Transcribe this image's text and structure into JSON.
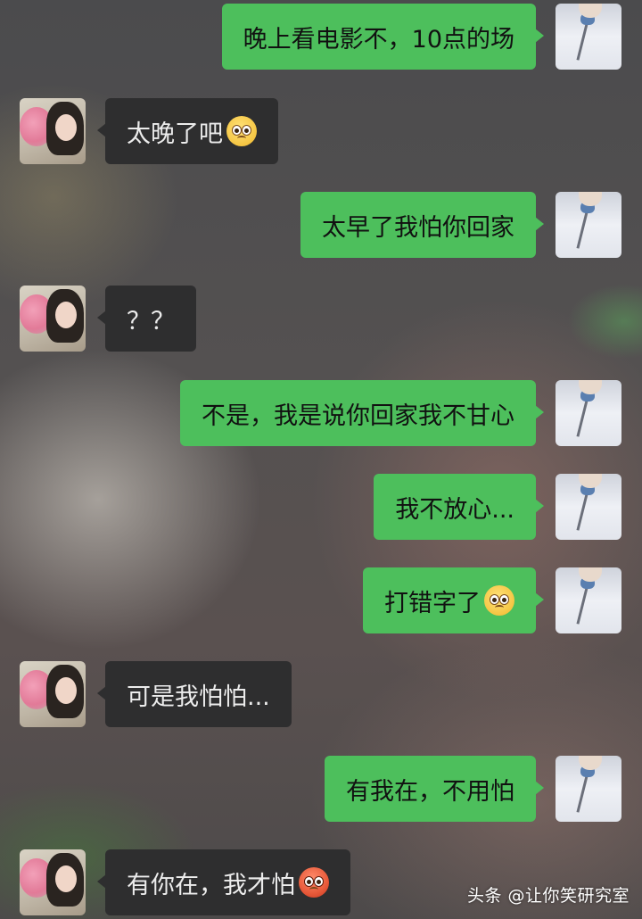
{
  "messages": [
    {
      "side": "right",
      "text": "晚上看电影不，10点的场"
    },
    {
      "side": "left",
      "text": "太晚了吧",
      "emoji": "flushed-face-emoji"
    },
    {
      "side": "right",
      "text": "太早了我怕你回家"
    },
    {
      "side": "left",
      "text": "？？"
    },
    {
      "side": "right",
      "text": "不是，我是说你回家我不甘心"
    },
    {
      "side": "right",
      "text": "我不放心..."
    },
    {
      "side": "right",
      "text": "打错字了",
      "emoji": "pleading-face-emoji"
    },
    {
      "side": "left",
      "text": "可是我怕怕..."
    },
    {
      "side": "right",
      "text": "有我在，不用怕"
    },
    {
      "side": "left",
      "text": "有你在，我才怕",
      "emoji": "angry-face-emoji"
    }
  ],
  "watermark": "头条 @让你笑研究室",
  "colors": {
    "sent_bubble": "#4dbf5c",
    "received_bubble": "#2e2e2f",
    "sent_text": "#111111",
    "received_text": "#ececec"
  }
}
